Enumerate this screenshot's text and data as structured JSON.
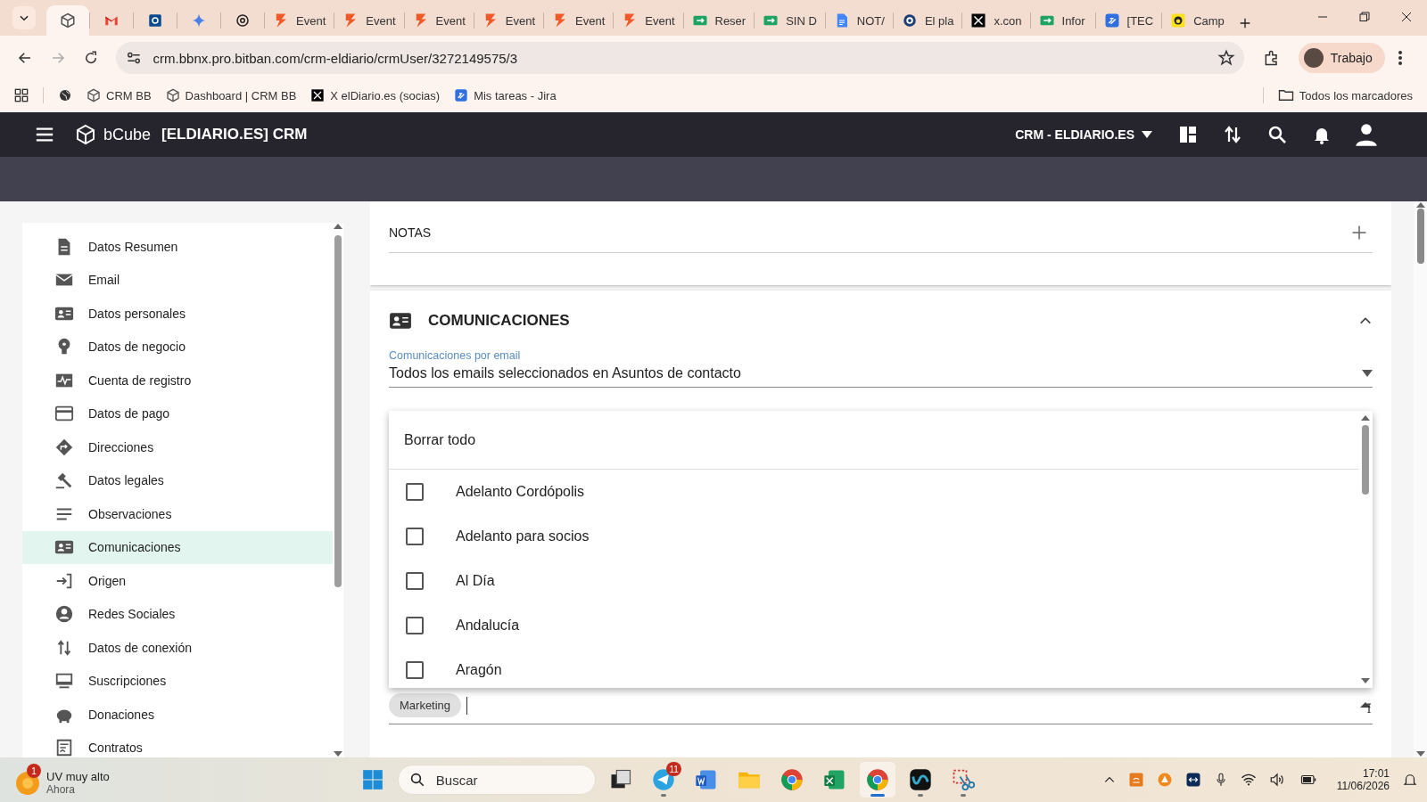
{
  "browser": {
    "tabs": [
      {
        "kind": "crm",
        "selected": true
      },
      {
        "kind": "gmail",
        "selected": false
      },
      {
        "kind": "outlook",
        "selected": false
      },
      {
        "kind": "gemini",
        "selected": false
      },
      {
        "kind": "chatgpt",
        "selected": false
      },
      {
        "kind": "event",
        "label": "Event",
        "selected": false
      },
      {
        "kind": "event",
        "label": "Event",
        "selected": false
      },
      {
        "kind": "event",
        "label": "Event",
        "selected": false
      },
      {
        "kind": "event",
        "label": "Event",
        "selected": false
      },
      {
        "kind": "event",
        "label": "Event",
        "selected": false
      },
      {
        "kind": "event",
        "label": "Event",
        "selected": false
      },
      {
        "kind": "sheet",
        "label": "Reser",
        "selected": false
      },
      {
        "kind": "sheet",
        "label": "SIN D",
        "selected": false
      },
      {
        "kind": "doc",
        "label": "NOT/",
        "selected": false
      },
      {
        "kind": "ring",
        "label": "El pla",
        "selected": false
      },
      {
        "kind": "x",
        "label": "x.con",
        "selected": false
      },
      {
        "kind": "sheet",
        "label": "Infor",
        "selected": false
      },
      {
        "kind": "jira",
        "label": "[TEC",
        "selected": false
      },
      {
        "kind": "mailchimp",
        "label": "Camp",
        "selected": false
      }
    ],
    "url": "crm.bbnx.pro.bitban.com/crm-eldiario/crmUser/3272149575/3",
    "profile": "Trabajo",
    "bookmarks": [
      {
        "kind": "globe"
      },
      {
        "kind": "crm",
        "label": "CRM BB"
      },
      {
        "kind": "crm",
        "label": "Dashboard | CRM BB"
      },
      {
        "kind": "x",
        "label": "X elDiario.es (socias)"
      },
      {
        "kind": "jira",
        "label": "Mis tareas - Jira"
      }
    ],
    "all_bookmarks": "Todos los marcadores"
  },
  "app": {
    "brand": "bCube",
    "title": "[ELDIARIO.ES] CRM",
    "account": "CRM - ELDIARIO.ES"
  },
  "sidebar": {
    "items": [
      {
        "kind": "document",
        "label": "Datos Resumen",
        "selected": false
      },
      {
        "kind": "mail",
        "label": "Email",
        "selected": false
      },
      {
        "kind": "idcard",
        "label": "Datos personales",
        "selected": false
      },
      {
        "kind": "bulb",
        "label": "Datos de negocio",
        "selected": false
      },
      {
        "kind": "pulse",
        "label": "Cuenta de registro",
        "selected": false
      },
      {
        "kind": "card",
        "label": "Datos de pago",
        "selected": false
      },
      {
        "kind": "diamond",
        "label": "Direcciones",
        "selected": false
      },
      {
        "kind": "gavel",
        "label": "Datos legales",
        "selected": false
      },
      {
        "kind": "lines",
        "label": "Observaciones",
        "selected": false
      },
      {
        "kind": "idcard",
        "label": "Comunicaciones",
        "selected": true
      },
      {
        "kind": "login",
        "label": "Origen",
        "selected": false
      },
      {
        "kind": "person",
        "label": "Redes Sociales",
        "selected": false
      },
      {
        "kind": "updown",
        "label": "Datos de conexión",
        "selected": false
      },
      {
        "kind": "monitor",
        "label": "Suscripciones",
        "selected": false
      },
      {
        "kind": "piggy",
        "label": "Donaciones",
        "selected": false
      },
      {
        "kind": "contract",
        "label": "Contratos",
        "selected": false
      }
    ]
  },
  "notes": {
    "title": "NOTAS"
  },
  "communications": {
    "title": "COMUNICACIONES",
    "expanded": true,
    "email_field": {
      "label": "Comunicaciones por email",
      "value": "Todos los emails seleccionados en Asuntos de contacto"
    },
    "dropdown": {
      "clear_all": "Borrar todo",
      "options": [
        {
          "label": "Adelanto Cordópolis",
          "checked": false
        },
        {
          "label": "Adelanto para socios",
          "checked": false
        },
        {
          "label": "Al Día",
          "checked": false
        },
        {
          "label": "Andalucía",
          "checked": false
        },
        {
          "label": "Aragón",
          "checked": false
        }
      ]
    },
    "chips": [
      {
        "label": "Marketing"
      }
    ]
  },
  "taskbar": {
    "notification": {
      "badge": "1",
      "title": "UV muy alto",
      "time": "Ahora"
    },
    "search": "Buscar",
    "apps": [
      {
        "kind": "taskview",
        "running": false,
        "selected": false
      },
      {
        "kind": "telegram",
        "badge": "11",
        "running": true,
        "selected": false
      },
      {
        "kind": "word",
        "running": false,
        "selected": false
      },
      {
        "kind": "files",
        "running": false,
        "selected": false
      },
      {
        "kind": "chrome",
        "running": false,
        "selected": false
      },
      {
        "kind": "excel",
        "running": false,
        "selected": false
      },
      {
        "kind": "chrome",
        "running": true,
        "selected": true
      },
      {
        "kind": "webex",
        "running": true,
        "selected": false
      },
      {
        "kind": "snip",
        "running": true,
        "selected": false
      }
    ],
    "time": "17:01",
    "date": "11/06/2026"
  }
}
